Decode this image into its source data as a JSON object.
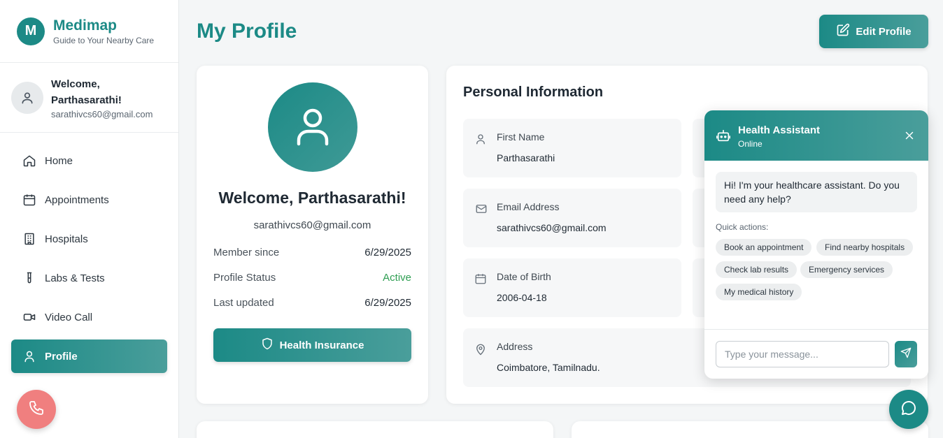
{
  "brand": {
    "logo_letter": "M",
    "name": "Medimap",
    "tagline": "Guide to Your Nearby Care",
    "accent": "#1c8a86"
  },
  "user": {
    "welcome": "Welcome, Parthasarathi!",
    "email": "sarathivcs60@gmail.com"
  },
  "nav": [
    {
      "label": "Home",
      "icon": "home-icon"
    },
    {
      "label": "Appointments",
      "icon": "calendar-icon"
    },
    {
      "label": "Hospitals",
      "icon": "building-icon"
    },
    {
      "label": "Labs & Tests",
      "icon": "test-tube-icon"
    },
    {
      "label": "Video Call",
      "icon": "video-icon"
    },
    {
      "label": "Profile",
      "icon": "user-icon",
      "active": true
    }
  ],
  "header": {
    "title": "My Profile",
    "edit_label": "Edit Profile"
  },
  "profile": {
    "welcome": "Welcome, Parthasarathi!",
    "email": "sarathivcs60@gmail.com",
    "rows": [
      {
        "label": "Member since",
        "value": "6/29/2025"
      },
      {
        "label": "Profile Status",
        "value": "Active",
        "status_color": "#2e9e52"
      },
      {
        "label": "Last updated",
        "value": "6/29/2025"
      }
    ],
    "insurance_label": "Health Insurance"
  },
  "personal": {
    "title": "Personal Information",
    "fields": [
      {
        "label": "First Name",
        "value": "Parthasarathi",
        "icon": "user-icon"
      },
      {
        "label": "Email Address",
        "value": "sarathivcs60@gmail.com",
        "icon": "mail-icon"
      },
      {
        "label": "Date of Birth",
        "value": "2006-04-18",
        "icon": "calendar-icon"
      },
      {
        "label": "Address",
        "value": "Coimbatore, Tamilnadu.",
        "icon": "map-pin-icon"
      }
    ]
  },
  "chat": {
    "title": "Health Assistant",
    "status": "Online",
    "greeting": "Hi! I'm your healthcare assistant. Do you need any help?",
    "quick_label": "Quick actions:",
    "quick_actions": [
      "Book an appointment",
      "Find nearby hospitals",
      "Check lab results",
      "Emergency services",
      "My medical history"
    ],
    "placeholder": "Type your message..."
  }
}
